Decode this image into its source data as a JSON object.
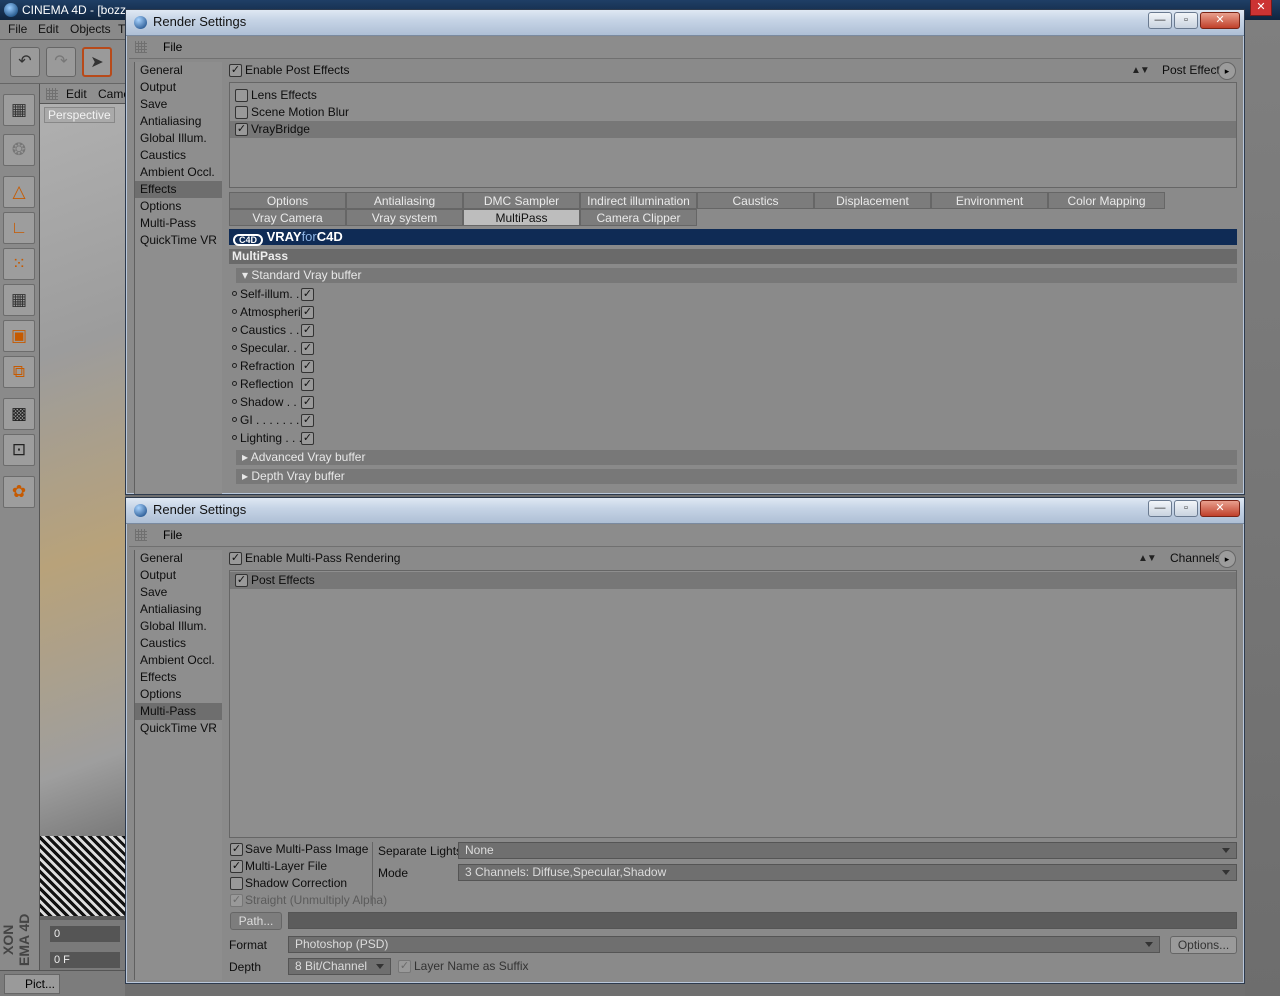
{
  "app": {
    "title": "CINEMA 4D - [bozz",
    "menu": [
      "File",
      "Edit",
      "Objects",
      "T"
    ],
    "viewport_menu": [
      "Edit",
      "Came"
    ],
    "viewport_label": "Perspective",
    "timeline_frame": "0",
    "timeline_field": "0 F",
    "brand": "XON EMA 4D",
    "taskbar_item": "Pict...",
    "close_glyph": "✕"
  },
  "top_window": {
    "title": "Render Settings",
    "menu_file": "File",
    "nav_items": [
      "General",
      "Output",
      "Save",
      "Antialiasing",
      "Global Illum.",
      "Caustics",
      "Ambient Occl.",
      "Effects",
      "Options",
      "Multi-Pass",
      "QuickTime VR"
    ],
    "nav_selected": "Effects",
    "enable_label": "Enable Post Effects",
    "enable_checked": true,
    "right_control_label": "Post Effect",
    "effects": [
      {
        "label": "Lens Effects",
        "checked": false
      },
      {
        "label": "Scene Motion Blur",
        "checked": false
      },
      {
        "label": "VrayBridge",
        "checked": true
      }
    ],
    "tabs_row1": [
      "Options",
      "Antialiasing",
      "DMC Sampler",
      "Indirect illumination (GI)",
      "Caustics",
      "Displacement",
      "Environment",
      "Color Mapping"
    ],
    "tabs_row2": [
      "Vray Camera",
      "Vray system",
      "MultiPass",
      "Camera Clipper"
    ],
    "active_tab": "MultiPass",
    "banner": {
      "vray": "VRAY",
      "for": "for",
      "c4d": "C4D",
      "logo": "C4D"
    },
    "section_title": "MultiPass",
    "standard_group": "Standard Vray buffer",
    "buffers": [
      {
        "label": "Self-illum. . . .",
        "checked": true
      },
      {
        "label": "Atmospheric",
        "checked": true
      },
      {
        "label": "Caustics . . . .",
        "checked": true
      },
      {
        "label": "Specular. . . .",
        "checked": true
      },
      {
        "label": "Refraction",
        "checked": true
      },
      {
        "label": "Reflection",
        "checked": true
      },
      {
        "label": "Shadow . . . .",
        "checked": true
      },
      {
        "label": "GI . . . . . . . .",
        "checked": true
      },
      {
        "label": "Lighting . . . .",
        "checked": true
      }
    ],
    "advanced_group": "Advanced Vray buffer",
    "depth_group": "Depth Vray buffer"
  },
  "bottom_window": {
    "title": "Render Settings",
    "menu_file": "File",
    "nav_items": [
      "General",
      "Output",
      "Save",
      "Antialiasing",
      "Global Illum.",
      "Caustics",
      "Ambient Occl.",
      "Effects",
      "Options",
      "Multi-Pass",
      "QuickTime VR"
    ],
    "nav_selected": "Multi-Pass",
    "enable_label": "Enable Multi-Pass Rendering",
    "enable_checked": true,
    "right_control_label": "Channels",
    "channels": [
      {
        "label": "Post Effects",
        "checked": true
      }
    ],
    "options": [
      {
        "label": "Save Multi-Pass Image",
        "checked": true,
        "disabled": false
      },
      {
        "label": "Multi-Layer File",
        "checked": true,
        "disabled": false
      },
      {
        "label": "Shadow Correction",
        "checked": false,
        "disabled": false
      },
      {
        "label": "Straight (Unmultiply Alpha)",
        "checked": true,
        "disabled": true
      }
    ],
    "separate_lights_label": "Separate Lights",
    "separate_lights_value": "None",
    "mode_label": "Mode",
    "mode_value": "3 Channels: Diffuse,Specular,Shadow",
    "path_button": "Path...",
    "path_value": "",
    "format_label": "Format",
    "format_value": "Photoshop (PSD)",
    "options_button": "Options...",
    "depth_label": "Depth",
    "depth_value": "8 Bit/Channel",
    "layer_name_label": "Layer Name as Suffix",
    "layer_name_checked": true
  },
  "glyphs": {
    "check": "✓",
    "minimize": "—",
    "maximize": "▫",
    "close": "✕",
    "expand_open": "▾",
    "expand_closed": "▸",
    "play": "▸",
    "up_down": "▲▼"
  },
  "colors": {
    "panel": "#8a8a8a",
    "selected": "#6e6e6e",
    "banner": "#0f2b55",
    "active_tab": "#bdbdbd"
  }
}
